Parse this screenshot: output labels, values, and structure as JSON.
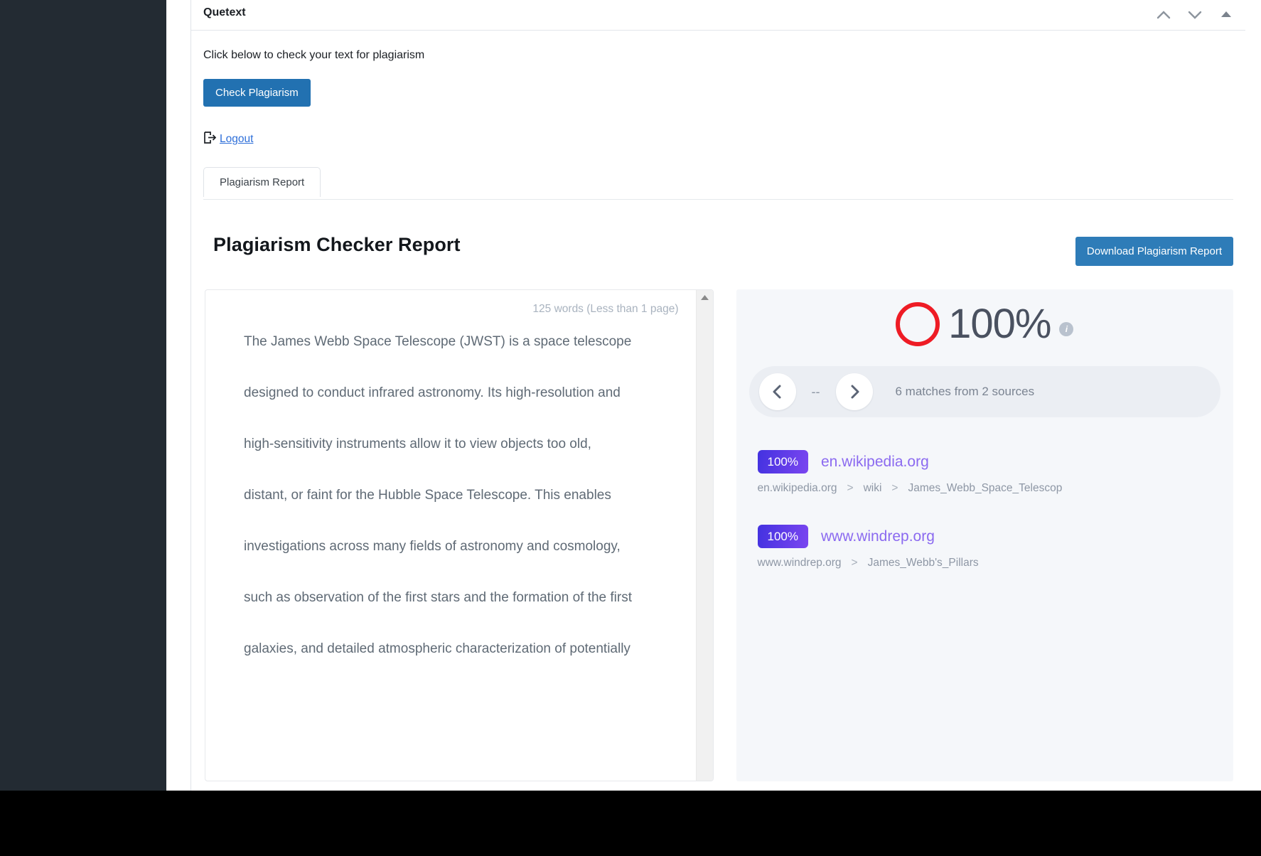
{
  "window": {
    "sidebar_color": "#232b33",
    "controls": [
      {
        "name": "collapse-up",
        "glyph": "chevron-up"
      },
      {
        "name": "expand-down",
        "glyph": "chevron-down"
      },
      {
        "name": "minimize",
        "glyph": "triangle-up"
      }
    ]
  },
  "panel": {
    "title": "Quetext",
    "lead": "Click below to check your text for plagiarism",
    "check_button": "Check Plagiarism",
    "logout": "Logout",
    "tab": "Plagiarism Report"
  },
  "report": {
    "title": "Plagiarism Checker Report",
    "download_button": "Download Plagiarism Report",
    "word_count": "125 words (Less than 1 page)",
    "lines": [
      [
        {
          "t": "The James Webb Space Telescope (JWST) is a space telescope",
          "m": true
        }
      ],
      [
        {
          "t": "designed to conduct infrared astronomy.",
          "m": true
        },
        {
          "t": " ",
          "m": false
        },
        {
          "t": "Its high-resolution and",
          "m": true
        }
      ],
      [
        {
          "t": "high-sensitivity instruments allow it to view objects too old,",
          "m": true
        }
      ],
      [
        {
          "t": "distant, or faint for the Hubble Space Telescope.",
          "m": true
        },
        {
          "t": " ",
          "m": false
        },
        {
          "t": "This enables",
          "m": true
        }
      ],
      [
        {
          "t": "investigations across many fields of astronomy and cosmology,",
          "m": true
        }
      ],
      [
        {
          "t": "such as observation of the first stars and the formation of the first",
          "m": true
        }
      ],
      [
        {
          "t": "galaxies, and detailed atmospheric characterization of potentially",
          "m": true
        }
      ]
    ]
  },
  "score": {
    "percent": "100%",
    "ring_color": "#ee1c25",
    "info_glyph": "i"
  },
  "matches": {
    "prev_label": "‹",
    "next_label": "›",
    "position": "--",
    "summary": "6 matches from 2 sources"
  },
  "sources": [
    {
      "percent": "100%",
      "url": "en.wikipedia.org",
      "crumbs": [
        "en.wikipedia.org",
        ">",
        "wiki",
        ">",
        "James_Webb_Space_Telescop"
      ]
    },
    {
      "percent": "100%",
      "url": "www.windrep.org",
      "crumbs": [
        "www.windrep.org",
        ">",
        "James_Webb's_Pillars"
      ]
    }
  ]
}
